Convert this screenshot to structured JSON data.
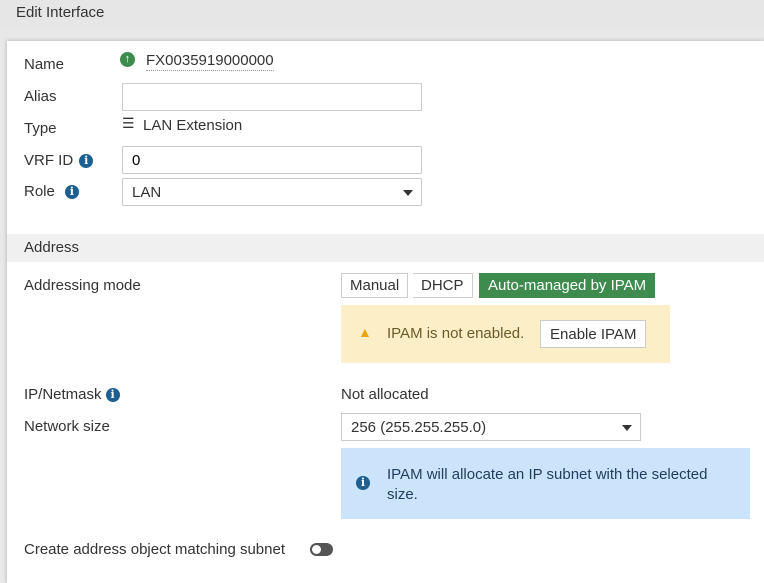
{
  "header": {
    "title": "Edit Interface"
  },
  "form": {
    "name_label": "Name",
    "name_value": "FX0035919000000",
    "alias_label": "Alias",
    "alias_value": "",
    "type_label": "Type",
    "type_value": "LAN Extension",
    "vrf_label": "VRF ID",
    "vrf_value": "0",
    "role_label": "Role",
    "role_value": "LAN"
  },
  "address": {
    "section_title": "Address",
    "mode_label": "Addressing mode",
    "modes": [
      "Manual",
      "DHCP",
      "Auto-managed by IPAM"
    ],
    "selected_mode": "Auto-managed by IPAM",
    "warning_text": "IPAM is not enabled.",
    "enable_button": "Enable IPAM",
    "ip_label": "IP/Netmask",
    "ip_value": "Not allocated",
    "size_label": "Network size",
    "size_value": "256 (255.255.255.0)",
    "info_text": "IPAM will allocate an IP subnet with the selected size.",
    "create_label": "Create address object matching subnet",
    "create_enabled": false
  },
  "colors": {
    "accent": "#3d8c4e",
    "warning_bg": "#fcefc7",
    "info_bg": "#cce4fb"
  }
}
